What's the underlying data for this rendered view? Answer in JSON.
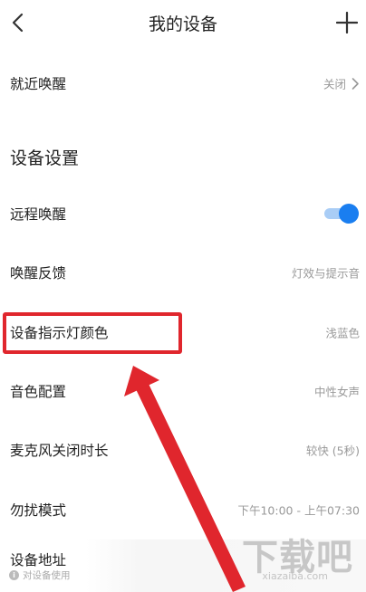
{
  "header": {
    "title": "我的设备",
    "back_icon": "chevron-left-icon",
    "add_icon": "plus-icon"
  },
  "nearby_wake": {
    "label": "就近唤醒",
    "value": "关闭"
  },
  "section": {
    "title": "设备设置"
  },
  "rows": {
    "remote_wake": {
      "label": "远程唤醒",
      "enabled": true
    },
    "wake_feedback": {
      "label": "唤醒反馈",
      "value": "灯效与提示音"
    },
    "indicator_color": {
      "label": "设备指示灯颜色",
      "value": "浅蓝色"
    },
    "voice_config": {
      "label": "音色配置",
      "value": "中性女声"
    },
    "mic_off_duration": {
      "label": "麦克风关闭时长",
      "value": "较快 (5秒)"
    },
    "dnd_mode": {
      "label": "勿扰模式",
      "value": "下午10:00 - 上午07:30"
    },
    "device_address": {
      "label": "设备地址"
    }
  },
  "hint": {
    "text": "对设备使用"
  },
  "watermark": {
    "text": "下载吧",
    "sub": "xiazaiba.com"
  },
  "colors": {
    "accent": "#1a7ef0",
    "highlight": "#e0262d"
  }
}
